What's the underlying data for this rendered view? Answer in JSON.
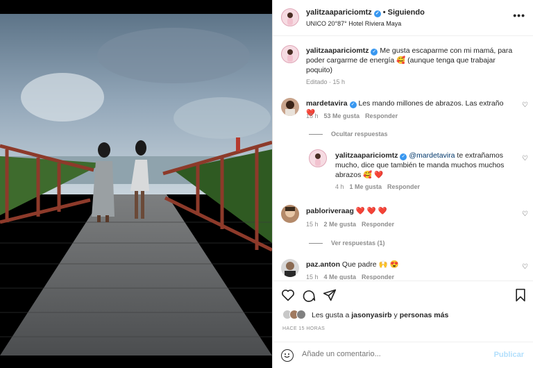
{
  "post": {
    "username": "yalitzaapariciomtz",
    "follow_label": "Siguiendo",
    "location": "UNICO 20°87° Hotel Riviera Maya",
    "more_icon": "•••"
  },
  "caption": {
    "username": "yalitzaapariciomtz",
    "text": "Me gusta escaparme con mi mamá, para poder cargarme de energía 🥰 (aunque tenga que trabajar poquito)",
    "meta": "Editado · 15 h"
  },
  "comments": [
    {
      "username": "mardetavira",
      "text": "Les mando millones de abrazos. Las extraño",
      "emoji": "❤️",
      "time": "15 h",
      "likes": "53 Me gusta",
      "reply": "Responder",
      "toggle": "Ocultar respuestas"
    },
    {
      "username": "yalitzaapariciomtz",
      "mention": "@mardetavira",
      "text": "te extrañamos mucho, dice que también te manda muchos muchos abrazos",
      "emoji": "🥰 ❤️",
      "time": "4 h",
      "likes": "1 Me gusta",
      "reply": "Responder"
    },
    {
      "username": "pabloriveraag",
      "text": "❤️ ❤️ ❤️",
      "time": "15 h",
      "likes": "2 Me gusta",
      "reply": "Responder",
      "toggle": "Ver respuestas (1)"
    },
    {
      "username": "paz.anton",
      "text": "Que padre",
      "emoji": "🙌 😍",
      "time": "15 h",
      "likes": "4 Me gusta",
      "reply": "Responder"
    }
  ],
  "likes": {
    "prefix": "Les gusta a",
    "user": "jasonyasirb",
    "conj": "y",
    "others": "personas más"
  },
  "timestamp": "HACE 15 HORAS",
  "composer": {
    "placeholder": "Añade un comentario...",
    "publish_label": "Publicar"
  },
  "icons": [
    "heart-icon",
    "comment-icon",
    "share-icon",
    "bookmark-icon",
    "emoji-icon",
    "more-icon",
    "verified-icon"
  ],
  "colors": {
    "verified": "#3897f0",
    "like_red": "#ed4956",
    "publish": "#b2dffc",
    "meta": "#8e8e8e"
  }
}
